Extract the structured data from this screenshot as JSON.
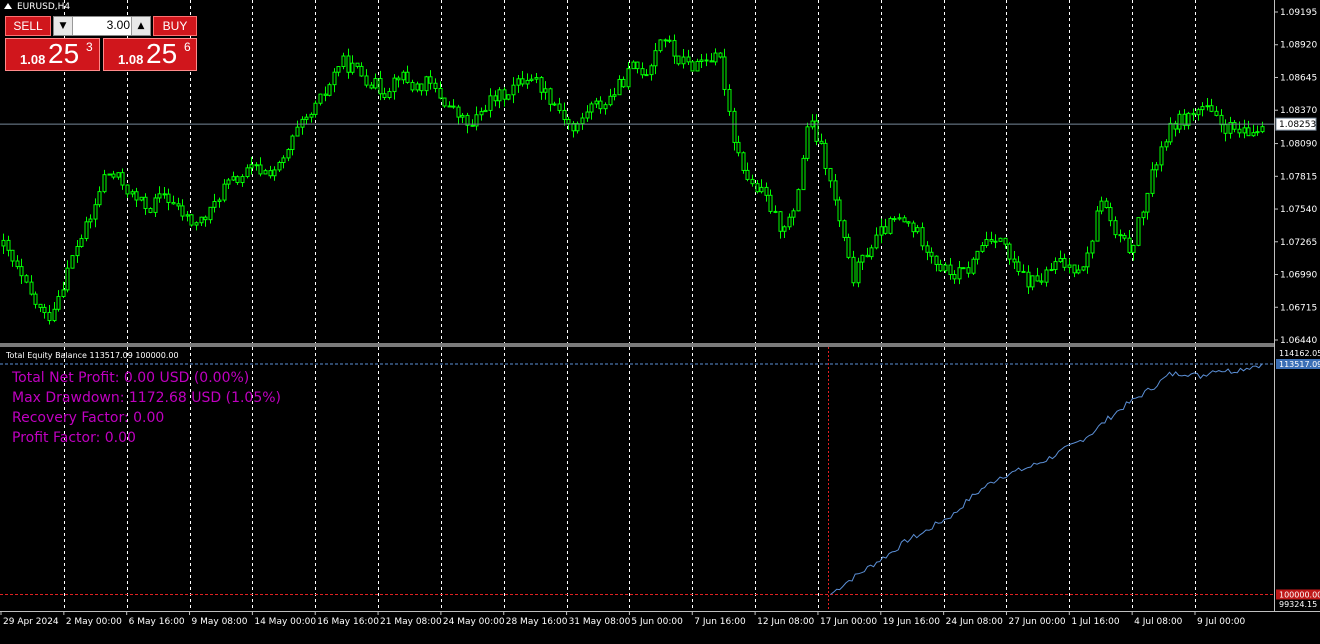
{
  "chart_title": "EURUSD,H4",
  "trade_panel": {
    "sell_label": "SELL",
    "buy_label": "BUY",
    "lot_value": "3.00",
    "sell_price_small": "1.08",
    "sell_price_big": "25",
    "sell_price_sup": "3",
    "buy_price_small": "1.08",
    "buy_price_big": "25",
    "buy_price_sup": "6"
  },
  "indicator": {
    "header": "Total Equity Balance 113517.09 100000.00",
    "stats": [
      "Total Net Profit: 0.00 USD (0.00%)",
      "Max Drawdown: 1172.68 USD (1.05%)",
      "Recovery Factor: 0.00",
      "Profit Factor: 0.00"
    ],
    "current_equity_label": "113517.09",
    "balance_label": "100000.00",
    "axis_labels": [
      "114162.05",
      "99324.15"
    ]
  },
  "colors": {
    "background": "#000000",
    "candles": "#00ff00",
    "grid": "#ffffff",
    "equity_line": "#5b8fd6",
    "stats_text": "#c000c0",
    "balance_line": "#e02020",
    "price_line": "#778899"
  },
  "chart_data": {
    "type": "line",
    "symbol": "EURUSD",
    "timeframe": "H4",
    "current_price": "1.08253",
    "y_ticks": [
      "1.09195",
      "1.08920",
      "1.08645",
      "1.08370",
      "1.08090",
      "1.07815",
      "1.07540",
      "1.07265",
      "1.06990",
      "1.06715",
      "1.06440"
    ],
    "ylim": [
      1.0644,
      1.09195
    ],
    "x_labels": [
      "29 Apr 2024",
      "2 May 00:00",
      "6 May 16:00",
      "9 May 08:00",
      "14 May 00:00",
      "16 May 16:00",
      "21 May 08:00",
      "24 May 00:00",
      "28 May 16:00",
      "31 May 08:00",
      "5 Jun 00:00",
      "7 Jun 16:00",
      "12 Jun 08:00",
      "17 Jun 00:00",
      "19 Jun 16:00",
      "24 Jun 08:00",
      "27 Jun 00:00",
      "1 Jul 16:00",
      "4 Jul 08:00",
      "9 Jul 00:00"
    ],
    "price_path": [
      1.0723,
      1.0701,
      1.0678,
      1.0661,
      1.0689,
      1.0723,
      1.0746,
      1.0785,
      1.0778,
      1.0762,
      1.0755,
      1.0767,
      1.0752,
      1.0741,
      1.0748,
      1.0772,
      1.0779,
      1.0788,
      1.0785,
      1.079,
      1.0818,
      1.0832,
      1.0852,
      1.0878,
      1.0872,
      1.0862,
      1.0852,
      1.0868,
      1.0856,
      1.086,
      1.0846,
      1.0833,
      1.0822,
      1.0843,
      1.0849,
      1.0858,
      1.0867,
      1.0853,
      1.0838,
      1.0818,
      1.084,
      1.0842,
      1.0856,
      1.0873,
      1.087,
      1.0902,
      1.088,
      1.0874,
      1.0882,
      1.0878,
      1.0808,
      1.0775,
      1.0765,
      1.074,
      1.0748,
      1.083,
      1.08,
      1.075,
      1.0695,
      1.0718,
      1.0735,
      1.0745,
      1.074,
      1.0725,
      1.0705,
      1.0698,
      1.0704,
      1.0728,
      1.0733,
      1.0705,
      1.0693,
      1.0695,
      1.0709,
      1.0705,
      1.071,
      1.0765,
      1.073,
      1.072,
      1.076,
      1.0805,
      1.0826,
      1.0832,
      1.084,
      1.0826,
      1.082,
      1.0815,
      1.0825
    ],
    "equity": {
      "start_x_label": "17 Jun 00:00",
      "start": 100000.0,
      "end": 113517.09,
      "path": [
        100000,
        100700,
        101300,
        101900,
        102500,
        103200,
        103600,
        104200,
        104700,
        105600,
        106300,
        106900,
        107200,
        107500,
        107900,
        108400,
        108900,
        109500,
        110300,
        111000,
        111600,
        112200,
        112900,
        113000,
        112800,
        113200,
        113100,
        113300,
        113517.09
      ]
    }
  }
}
